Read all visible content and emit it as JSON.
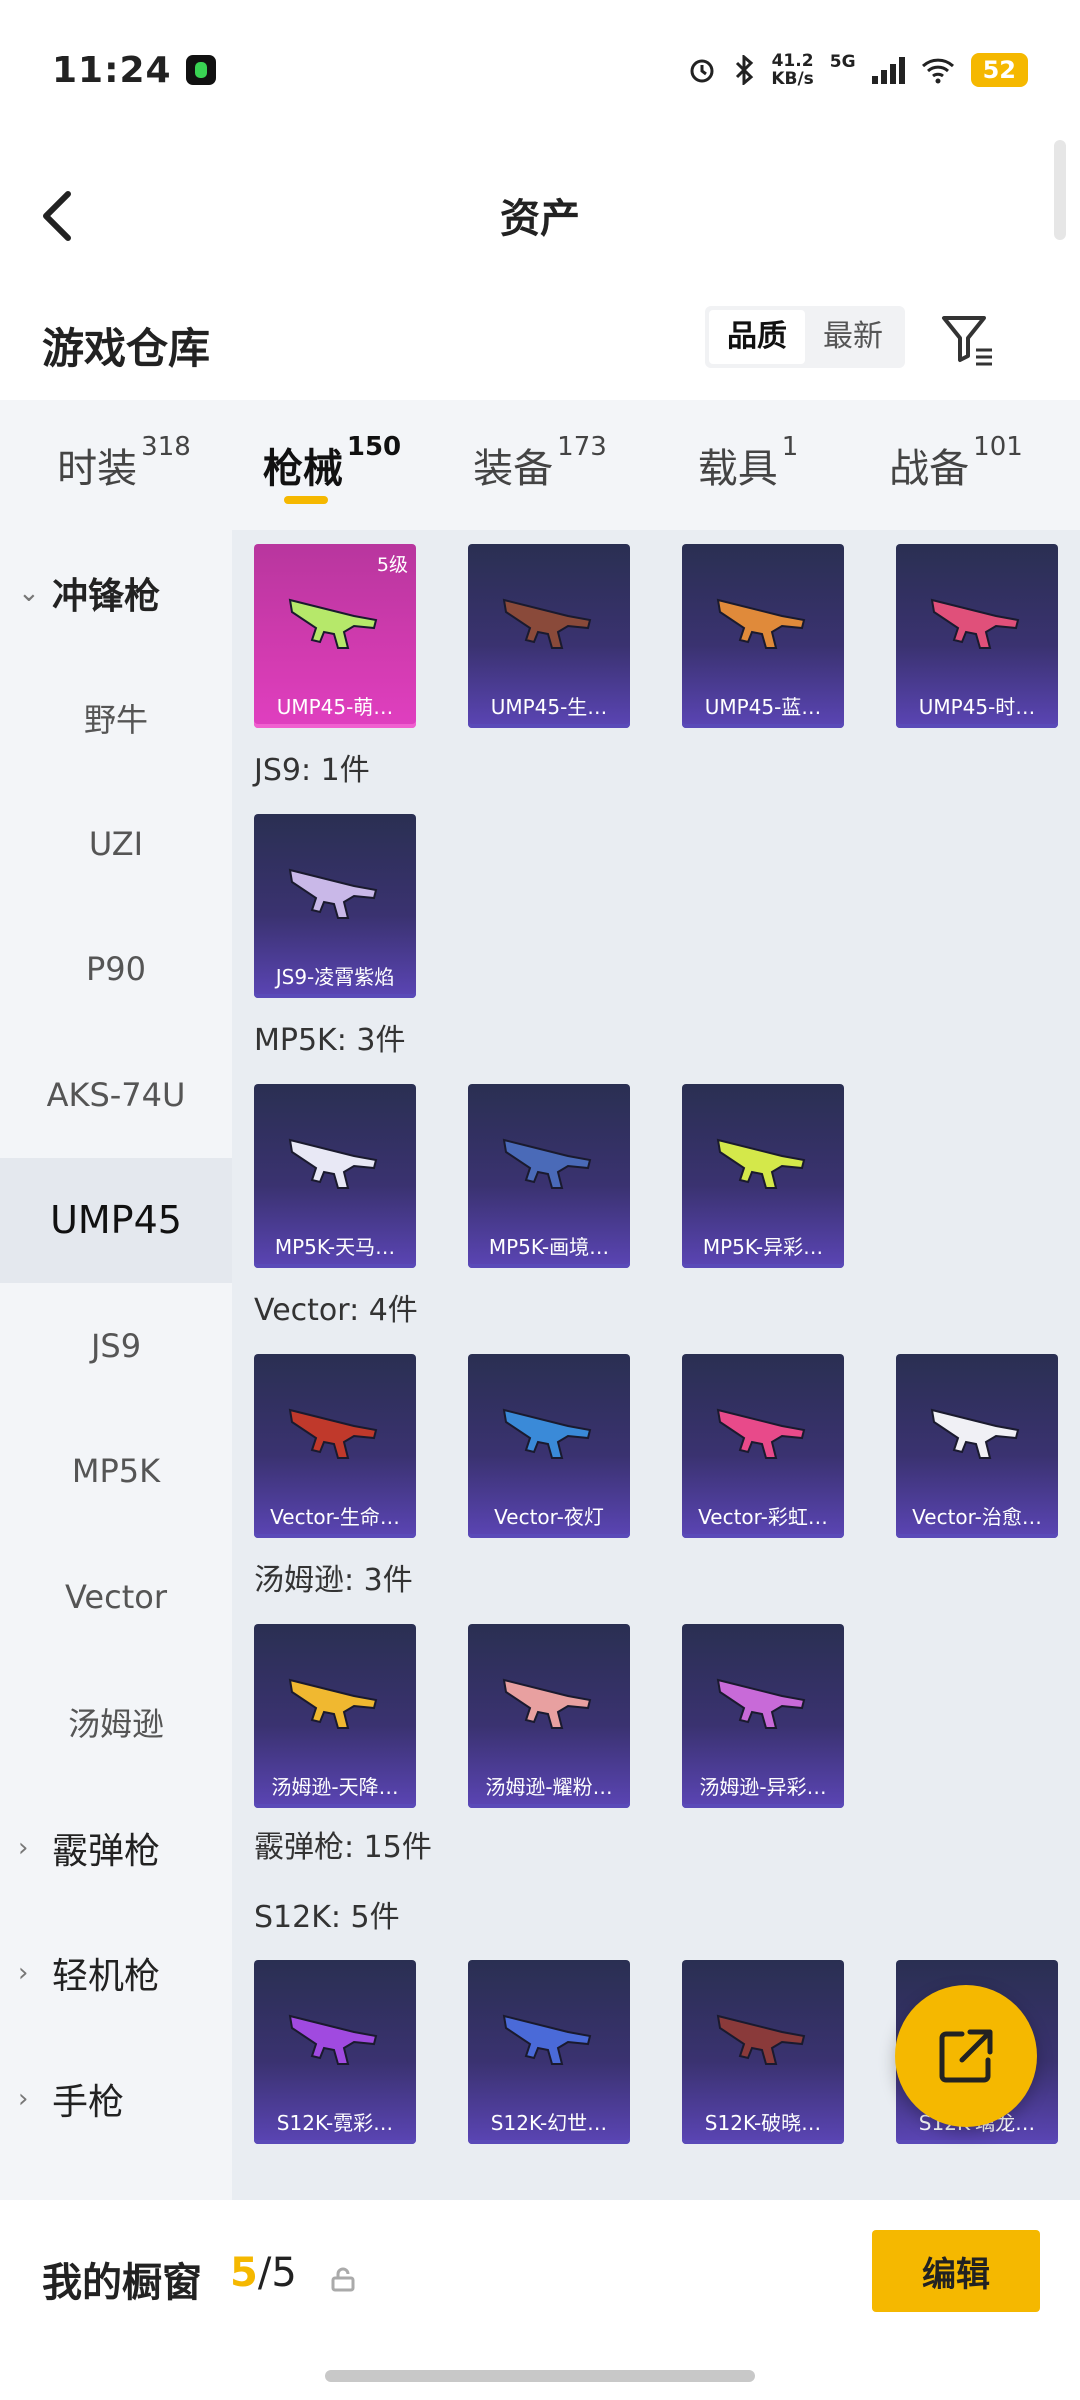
{
  "status_bar": {
    "time": "11:24",
    "speed_top": "41.2",
    "speed_bottom": "KB/s",
    "network": "5G",
    "battery": "52"
  },
  "header": {
    "title": "资产"
  },
  "warehouse": {
    "title": "游戏仓库",
    "sort_options": [
      "品质",
      "最新"
    ],
    "sort_selected": "品质"
  },
  "tabs": [
    {
      "label": "时装",
      "count": "318"
    },
    {
      "label": "枪械",
      "count": "150",
      "active": true
    },
    {
      "label": "装备",
      "count": "173"
    },
    {
      "label": "载具",
      "count": "1"
    },
    {
      "label": "战备",
      "count": "101"
    }
  ],
  "sidebar": {
    "items": [
      {
        "label": "冲锋枪",
        "type": "group",
        "expanded": true,
        "chevron": "⌄"
      },
      {
        "label": "野牛"
      },
      {
        "label": "UZI"
      },
      {
        "label": "P90"
      },
      {
        "label": "AKS-74U"
      },
      {
        "label": "UMP45",
        "active": true
      },
      {
        "label": "JS9"
      },
      {
        "label": "MP5K"
      },
      {
        "label": "Vector"
      },
      {
        "label": "汤姆逊"
      },
      {
        "label": "霰弹枪",
        "type": "group",
        "chevron": "›"
      },
      {
        "label": "轻机枪",
        "type": "group",
        "chevron": "›"
      },
      {
        "label": "手枪",
        "type": "group",
        "chevron": "›"
      }
    ]
  },
  "content": {
    "ump45_cards": [
      {
        "label": "UMP45-萌…",
        "level": "5级",
        "style": "pink",
        "gun_color": "#b6e86a"
      },
      {
        "label": "UMP45-生…",
        "gun_color": "#8a4a3a"
      },
      {
        "label": "UMP45-蓝…",
        "gun_color": "#e08a3a"
      },
      {
        "label": "UMP45-时…",
        "gun_color": "#e0507a"
      }
    ],
    "js9": {
      "title": "JS9: 1件",
      "cards": [
        {
          "label": "JS9-凌霄紫焰",
          "gun_color": "#c9b8e8"
        }
      ]
    },
    "mp5k": {
      "title": "MP5K: 3件",
      "cards": [
        {
          "label": "MP5K-天马…",
          "gun_color": "#e8e8f5"
        },
        {
          "label": "MP5K-画境…",
          "gun_color": "#4a6ab8"
        },
        {
          "label": "MP5K-异彩…",
          "gun_color": "#d4e84a"
        }
      ]
    },
    "vector": {
      "title": "Vector: 4件",
      "cards": [
        {
          "label": "Vector-生命…",
          "gun_color": "#c0392b"
        },
        {
          "label": "Vector-夜灯",
          "gun_color": "#3a8ad8"
        },
        {
          "label": "Vector-彩虹…",
          "gun_color": "#e84a8a"
        },
        {
          "label": "Vector-治愈…",
          "gun_color": "#f0f0f5"
        }
      ]
    },
    "thompson": {
      "title": "汤姆逊: 3件",
      "cards": [
        {
          "label": "汤姆逊-天降…",
          "gun_color": "#f0b830"
        },
        {
          "label": "汤姆逊-耀粉…",
          "gun_color": "#e8a0a0"
        },
        {
          "label": "汤姆逊-异彩…",
          "gun_color": "#c86ad8"
        }
      ]
    },
    "shotgun_title": "霰弹枪: 15件",
    "s12k": {
      "title": "S12K: 5件",
      "cards": [
        {
          "label": "S12K-霓彩…",
          "gun_color": "#a04ae0"
        },
        {
          "label": "S12K-幻世…",
          "gun_color": "#4a6ad8"
        },
        {
          "label": "S12K-破晓…",
          "gun_color": "#8a3a3a"
        },
        {
          "label": "S12K-璃龙…",
          "gun_color": "#5ac8e8"
        }
      ]
    }
  },
  "bottom": {
    "label": "我的橱窗",
    "count_current": "5",
    "count_total": "/5",
    "edit_label": "编辑"
  },
  "colors": {
    "accent": "#f5b800"
  },
  "icons": [
    "back-arrow-icon",
    "filter-icon",
    "lock-icon",
    "share-icon",
    "alarm-icon",
    "bluetooth-icon",
    "wifi-icon"
  ]
}
